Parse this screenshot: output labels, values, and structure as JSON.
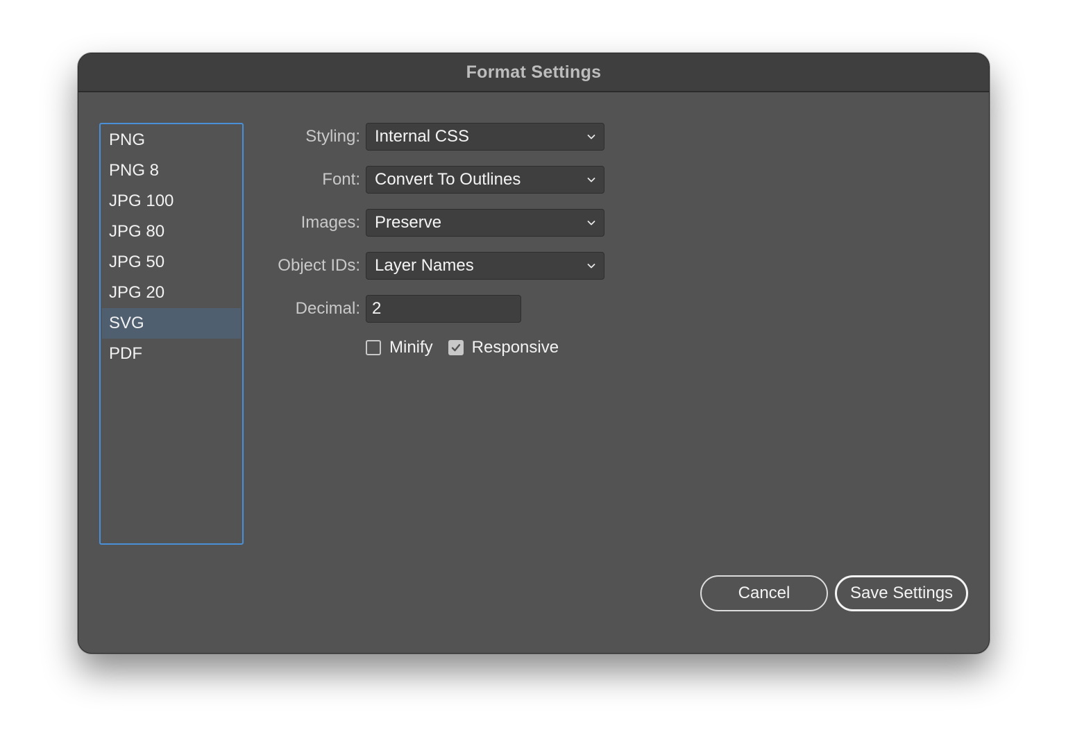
{
  "dialog": {
    "title": "Format Settings"
  },
  "formats": {
    "items": [
      "PNG",
      "PNG 8",
      "JPG 100",
      "JPG 80",
      "JPG 50",
      "JPG 20",
      "SVG",
      "PDF"
    ],
    "selected": "SVG"
  },
  "settings": {
    "styling": {
      "label": "Styling:",
      "value": "Internal CSS"
    },
    "font": {
      "label": "Font:",
      "value": "Convert To Outlines"
    },
    "images": {
      "label": "Images:",
      "value": "Preserve"
    },
    "object_ids": {
      "label": "Object IDs:",
      "value": "Layer Names"
    },
    "decimal": {
      "label": "Decimal:",
      "value": "2"
    },
    "minify": {
      "label": "Minify",
      "checked": false
    },
    "responsive": {
      "label": "Responsive",
      "checked": true
    }
  },
  "buttons": {
    "cancel": "Cancel",
    "save": "Save Settings"
  },
  "icons": {
    "dropdown": "chevron-down-icon",
    "checkmark": "checkmark-icon"
  },
  "colors": {
    "dialog_bg": "#535353",
    "titlebar_bg": "#3f3f3f",
    "list_focus_border": "#4a90d9",
    "selected_row": "#4f5f70"
  }
}
